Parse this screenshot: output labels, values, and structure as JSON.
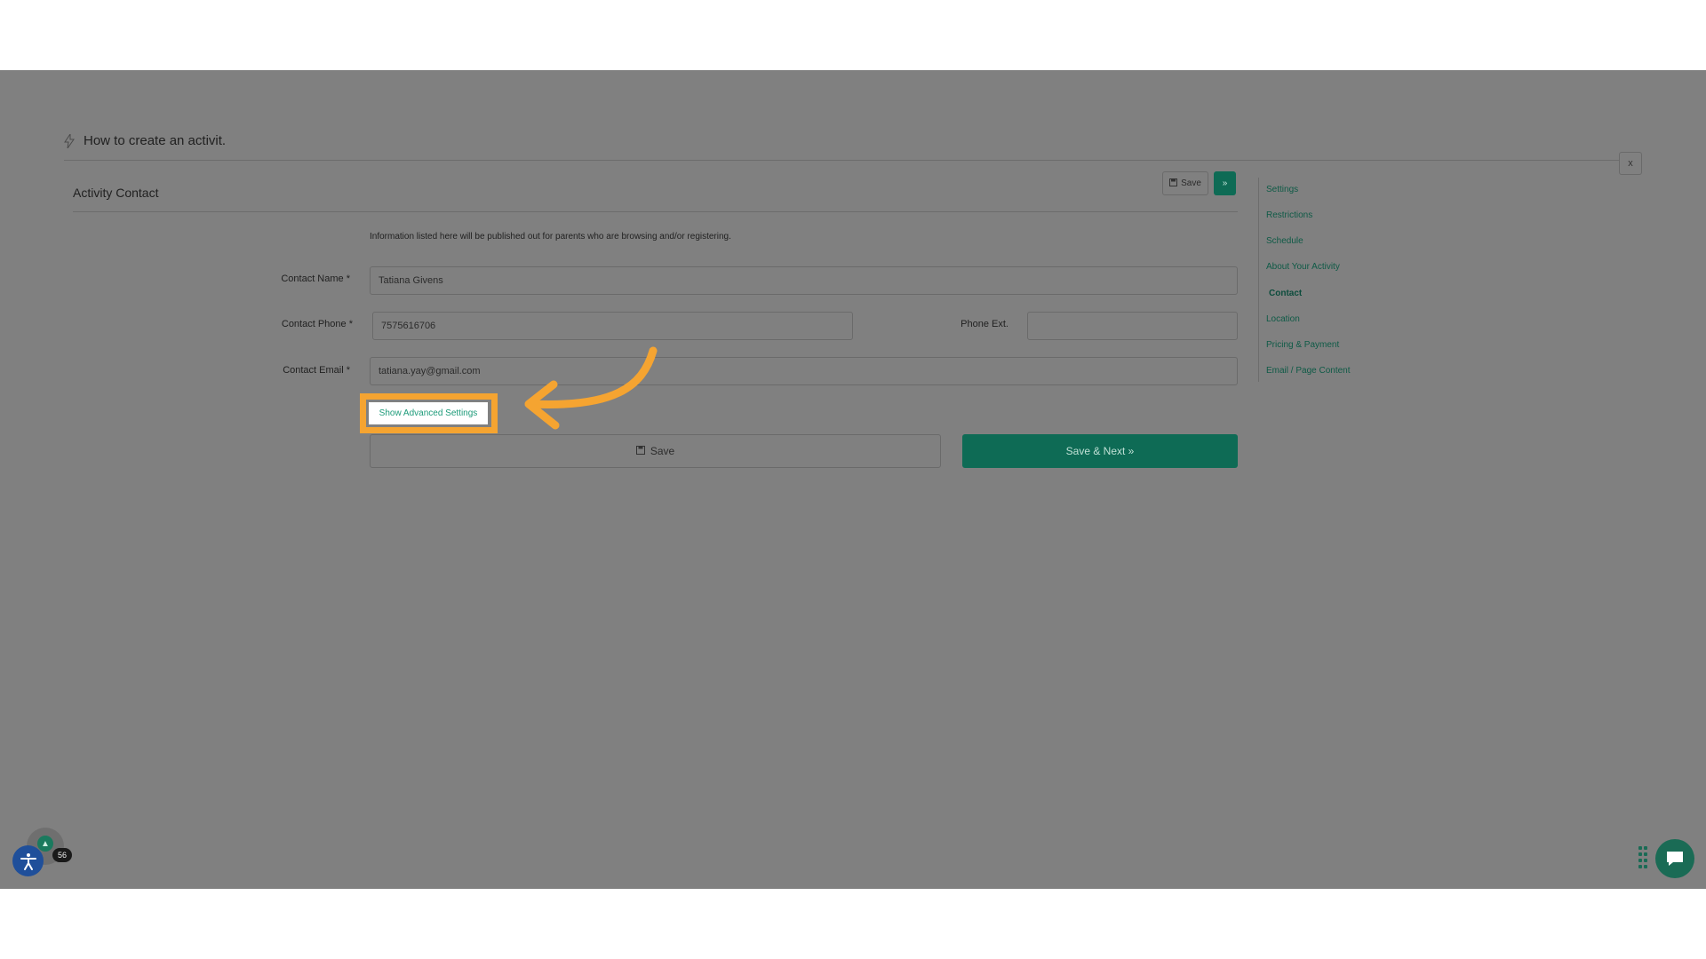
{
  "header": {
    "title": "How to create an activit.",
    "close_label": "x"
  },
  "section": {
    "title": "Activity Contact",
    "save_label": "Save",
    "next_label": "»",
    "info": "Information listed here will be published out for parents who are browsing and/or registering."
  },
  "form": {
    "contact_name": {
      "label": "Contact Name *",
      "value": "Tatiana  Givens"
    },
    "contact_phone": {
      "label": "Contact Phone *",
      "value": "7575616706"
    },
    "phone_ext": {
      "label": "Phone Ext.",
      "value": ""
    },
    "contact_email": {
      "label": "Contact Email *",
      "value": "tatiana.yay@gmail.com"
    },
    "advanced_label": "Show Advanced Settings",
    "save_label": "Save",
    "save_next_label": "Save & Next »"
  },
  "side_nav": {
    "items": [
      {
        "label": "Settings"
      },
      {
        "label": "Restrictions"
      },
      {
        "label": "Schedule"
      },
      {
        "label": "About Your Activity"
      },
      {
        "label": "Contact"
      },
      {
        "label": "Location"
      },
      {
        "label": "Pricing & Payment"
      },
      {
        "label": "Email / Page Content"
      }
    ],
    "active": "Contact"
  },
  "widgets": {
    "badge_count": "56"
  },
  "colors": {
    "accent": "#0e6b55",
    "highlight": "#f5a431",
    "overlay": "#808080"
  }
}
